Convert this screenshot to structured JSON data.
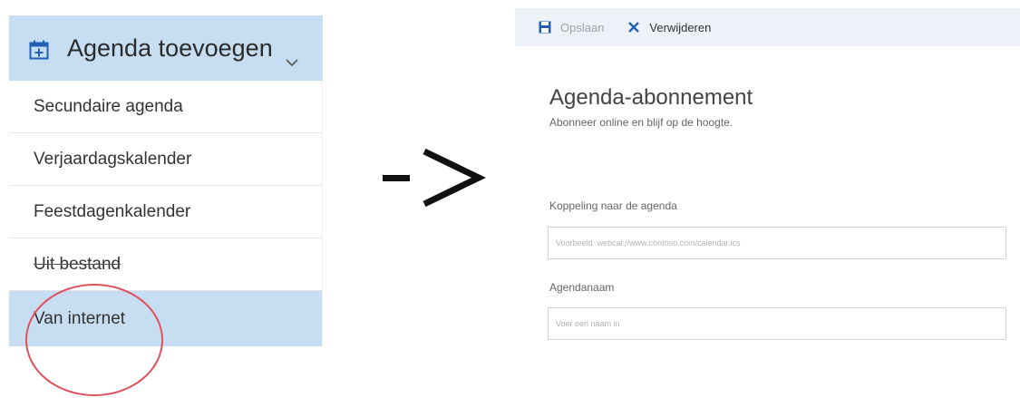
{
  "menu": {
    "header_label": "Agenda toevoegen",
    "items": [
      {
        "label": "Secundaire agenda"
      },
      {
        "label": "Verjaardagskalender"
      },
      {
        "label": "Feestdagenkalender"
      },
      {
        "label": "Uit bestand"
      },
      {
        "label": "Van internet"
      }
    ],
    "selected_color": "#c7ddf1"
  },
  "arrow_text": "->",
  "toolbar": {
    "save_label": "Opslaan",
    "delete_label": "Verwijderen",
    "accent": "#1f5fb4"
  },
  "form": {
    "title": "Agenda-abonnement",
    "subtitle": "Abonneer online en blijf op de hoogte.",
    "link_label": "Koppeling naar de agenda",
    "link_placeholder": "Voorbeeld: webcal://www.contoso.com/calendar.ics",
    "name_label": "Agendanaam",
    "name_placeholder": "Voer een naam in"
  },
  "annotation": {
    "circle_color": "#e0505a"
  }
}
